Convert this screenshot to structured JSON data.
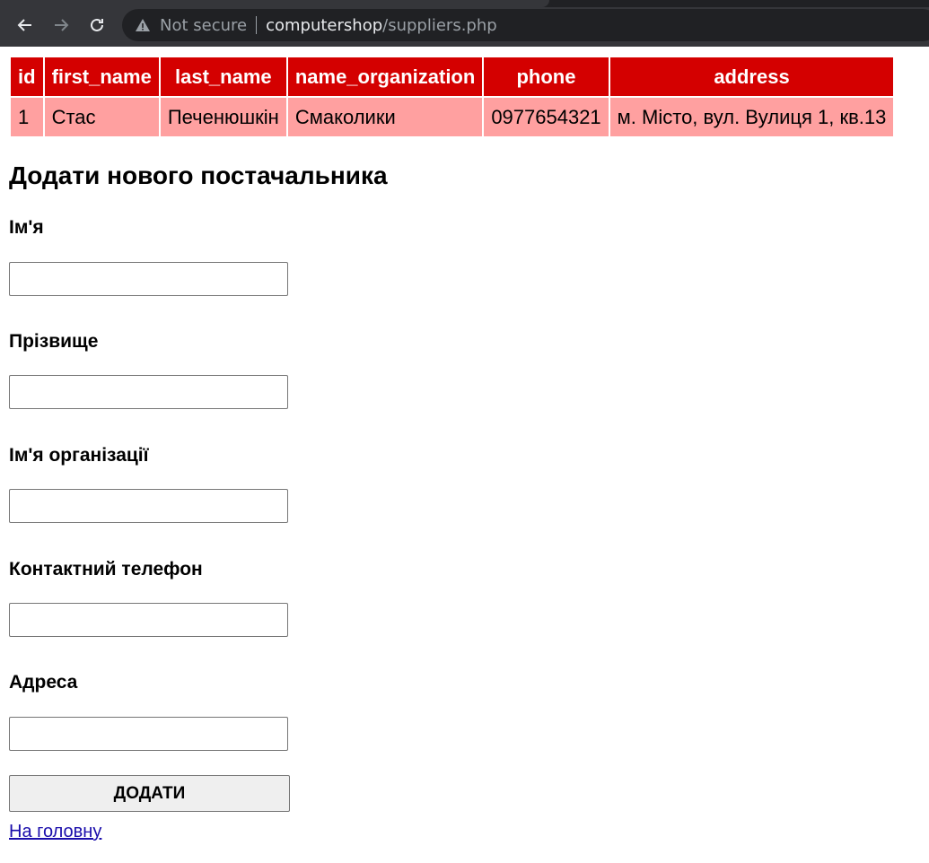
{
  "browser": {
    "security_text": "Not secure",
    "url_host": "computershop",
    "url_path": "/suppliers.php"
  },
  "table": {
    "headers": [
      "id",
      "first_name",
      "last_name",
      "name_organization",
      "phone",
      "address"
    ],
    "rows": [
      [
        "1",
        "Стас",
        "Печенюшкін",
        "Смаколики",
        "0977654321",
        "м. Місто, вул. Вулиця 1, кв.13"
      ]
    ]
  },
  "form": {
    "title": "Додати нового постачальника",
    "fields": [
      {
        "label": "Ім'я",
        "value": ""
      },
      {
        "label": "Прізвище",
        "value": ""
      },
      {
        "label": "Ім'я організації",
        "value": ""
      },
      {
        "label": "Контактний телефон",
        "value": ""
      },
      {
        "label": "Адреса",
        "value": ""
      }
    ],
    "submit_label": "ДОДАТИ",
    "home_link": "На головну"
  },
  "colors": {
    "header_bg": "#d40000",
    "row_bg": "#ffa0a0"
  }
}
